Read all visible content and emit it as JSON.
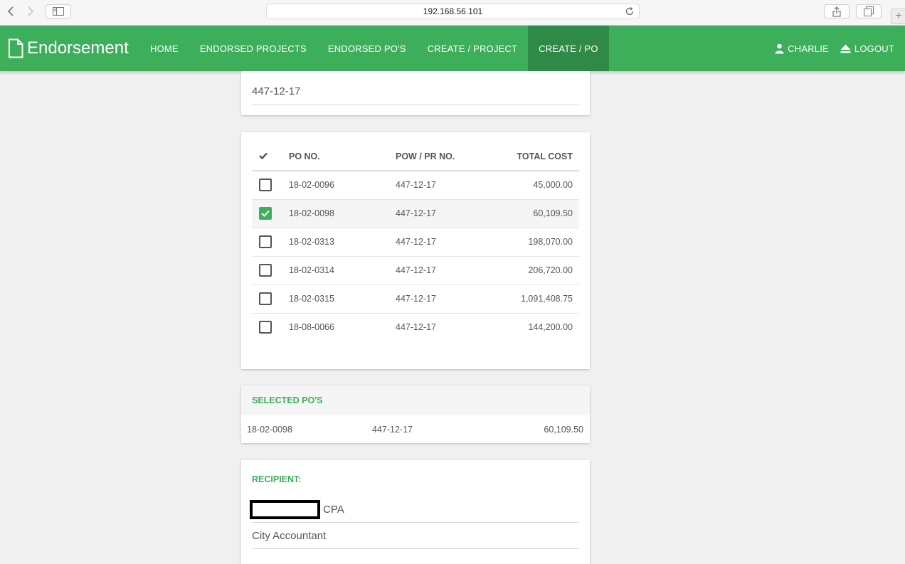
{
  "browser": {
    "url": "192.168.56.101",
    "new_tab_label": "+"
  },
  "nav": {
    "brand": "Endorsement",
    "items": [
      {
        "label": "HOME"
      },
      {
        "label": "ENDORSED PROJECTS"
      },
      {
        "label": "ENDORSED PO'S"
      },
      {
        "label": "CREATE / PROJECT"
      },
      {
        "label": "CREATE / PO",
        "active": true
      }
    ],
    "user": "CHARLIE",
    "logout": "LOGOUT"
  },
  "project_field": {
    "value": "447-12-17"
  },
  "po_table": {
    "headers": {
      "po_no": "PO NO.",
      "pow_pr_no": "POW / PR NO.",
      "total_cost": "TOTAL COST"
    },
    "rows": [
      {
        "po_no": "18-02-0096",
        "pow_pr_no": "447-12-17",
        "total_cost": "45,000.00",
        "checked": false
      },
      {
        "po_no": "18-02-0098",
        "pow_pr_no": "447-12-17",
        "total_cost": "60,109.50",
        "checked": true
      },
      {
        "po_no": "18-02-0313",
        "pow_pr_no": "447-12-17",
        "total_cost": "198,070.00",
        "checked": false
      },
      {
        "po_no": "18-02-0314",
        "pow_pr_no": "447-12-17",
        "total_cost": "206,720.00",
        "checked": false
      },
      {
        "po_no": "18-02-0315",
        "pow_pr_no": "447-12-17",
        "total_cost": "1,091,408.75",
        "checked": false
      },
      {
        "po_no": "18-08-0066",
        "pow_pr_no": "447-12-17",
        "total_cost": "144,200.00",
        "checked": false
      }
    ]
  },
  "selected_pos": {
    "title": "SELECTED PO'S",
    "rows": [
      {
        "po_no": "18-02-0098",
        "pow_pr_no": "447-12-17",
        "total_cost": "60,109.50"
      }
    ]
  },
  "recipient": {
    "label": "RECIPIENT:",
    "name_suffix": "CPA",
    "title": "City Accountant"
  },
  "colors": {
    "primary": "#3daf5b",
    "primary_dark": "#2f8a47",
    "background": "#f0f0f0"
  }
}
